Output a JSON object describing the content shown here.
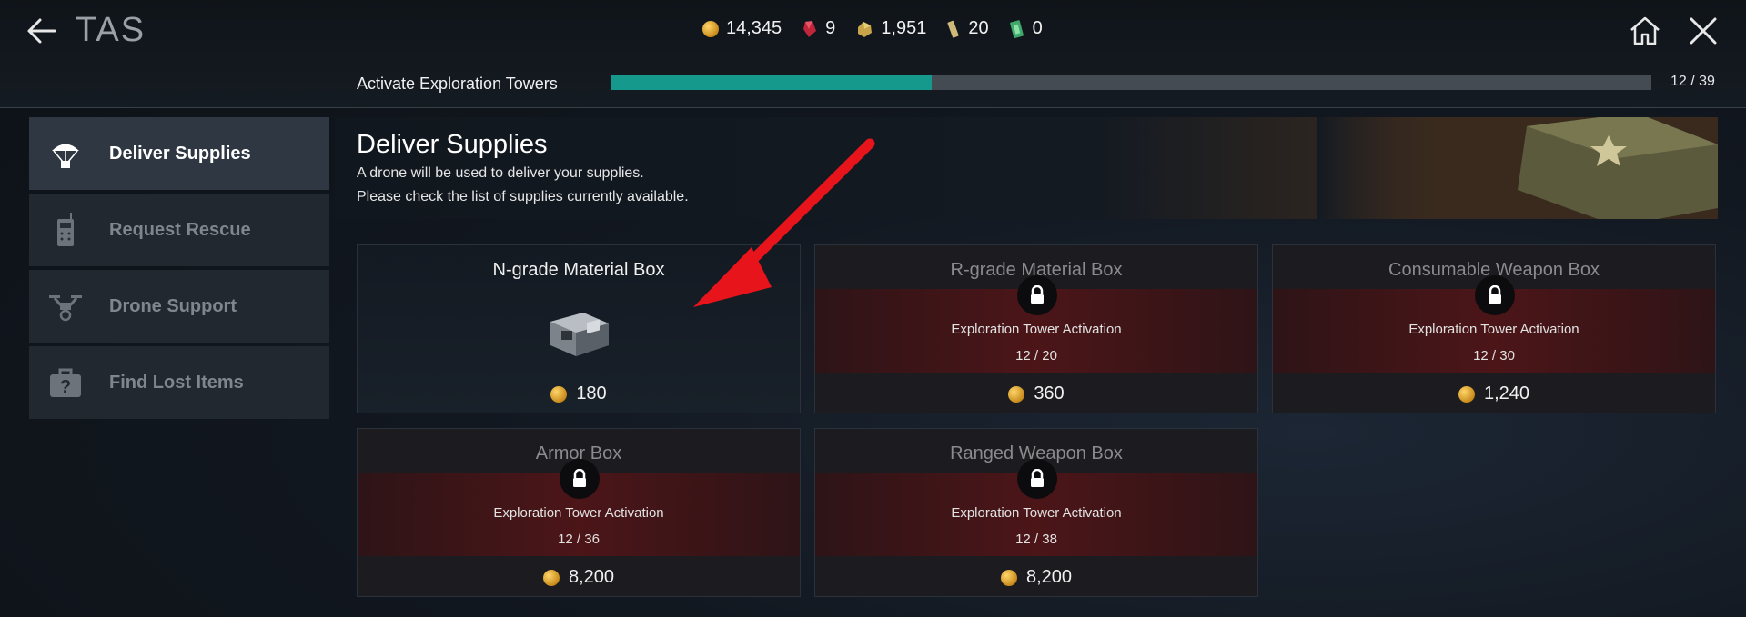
{
  "header": {
    "title": "TAS",
    "currencies": [
      {
        "icon": "gold-coin-icon",
        "value": "14,345"
      },
      {
        "icon": "red-gem-icon",
        "value": "9"
      },
      {
        "icon": "material-ore-icon",
        "value": "1,951"
      },
      {
        "icon": "ticket-icon",
        "value": "20"
      },
      {
        "icon": "cash-icon",
        "value": "0"
      }
    ]
  },
  "progress": {
    "label": "Activate Exploration Towers",
    "count": "12 / 39",
    "fraction": 0.308
  },
  "sidebar": {
    "items": [
      {
        "label": "Deliver Supplies",
        "icon": "parachute-icon",
        "active": true
      },
      {
        "label": "Request Rescue",
        "icon": "sos-radio-icon",
        "active": false
      },
      {
        "label": "Drone Support",
        "icon": "drone-icon",
        "active": false
      },
      {
        "label": "Find Lost Items",
        "icon": "lost-bag-icon",
        "active": false
      }
    ]
  },
  "main": {
    "title": "Deliver Supplies",
    "desc1": "A drone will be used to deliver your supplies.",
    "desc2": "Please check the list of supplies currently available."
  },
  "boxes": [
    {
      "name": "N-grade Material Box",
      "locked": false,
      "price": "180"
    },
    {
      "name": "R-grade Material Box",
      "locked": true,
      "req_label": "Exploration Tower Activation",
      "req_count": "12 / 20",
      "price": "360"
    },
    {
      "name": "Consumable Weapon Box",
      "locked": true,
      "req_label": "Exploration Tower Activation",
      "req_count": "12 / 30",
      "price": "1,240"
    },
    {
      "name": "Armor Box",
      "locked": true,
      "req_label": "Exploration Tower Activation",
      "req_count": "12 / 36",
      "price": "8,200"
    },
    {
      "name": "Ranged Weapon Box",
      "locked": true,
      "req_label": "Exploration Tower Activation",
      "req_count": "12 / 38",
      "price": "8,200"
    }
  ],
  "colors": {
    "progress_fill": "#14998c",
    "accent_arrow": "#e8141b",
    "locked_band": "#581416"
  }
}
